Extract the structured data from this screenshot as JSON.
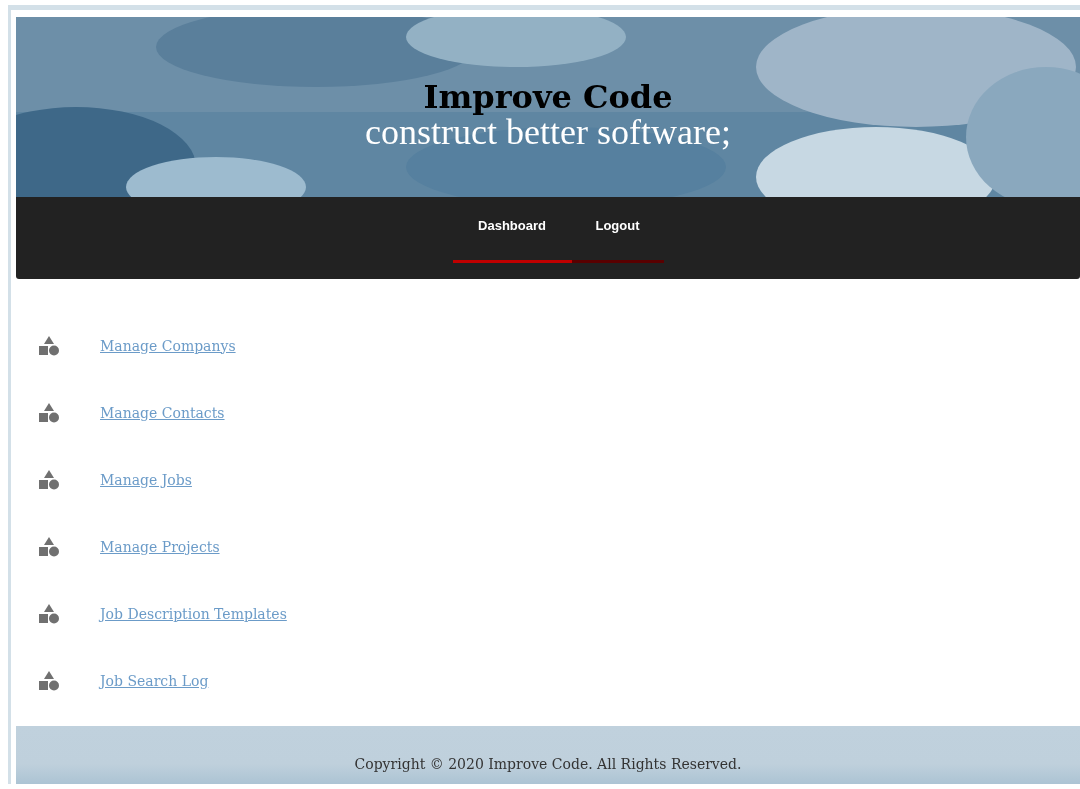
{
  "header": {
    "title": "Improve Code",
    "tagline": "construct better software;"
  },
  "nav": [
    {
      "label": "Dashboard",
      "selected": true
    },
    {
      "label": "Logout",
      "selected": false
    }
  ],
  "links": [
    {
      "label": "Manage Companys"
    },
    {
      "label": "Manage Contacts"
    },
    {
      "label": "Manage Jobs"
    },
    {
      "label": "Manage Projects"
    },
    {
      "label": "Job Description Templates"
    },
    {
      "label": "Job Search Log"
    }
  ],
  "footer": {
    "text": "Copyright © 2020 Improve Code. All Rights Reserved."
  }
}
